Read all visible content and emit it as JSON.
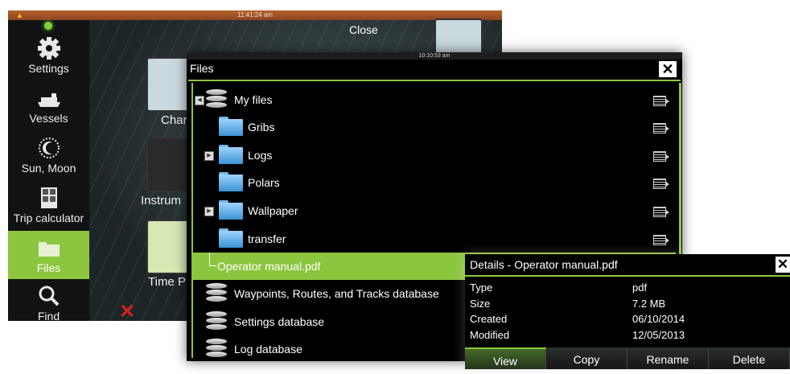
{
  "home": {
    "clock": "11:41:24 am",
    "close_label": "Close",
    "sidebar": [
      {
        "label": "Settings",
        "icon": "gear-icon"
      },
      {
        "label": "Vessels",
        "icon": "vessels-icon"
      },
      {
        "label": "Sun, Moon",
        "icon": "sun-moon-icon"
      },
      {
        "label": "Trip calculator",
        "icon": "calculator-icon"
      },
      {
        "label": "Files",
        "icon": "folder-icon",
        "active": true
      },
      {
        "label": "Find",
        "icon": "magnifier-icon"
      }
    ],
    "apps": [
      "Char",
      "Instrum",
      "Time P"
    ]
  },
  "files": {
    "clock": "10:10:53 am",
    "title": "Files",
    "items": [
      {
        "label": "My files",
        "icon": "database-icon"
      },
      {
        "label": "Gribs",
        "icon": "folder-icon"
      },
      {
        "label": "Logs",
        "icon": "folder-icon"
      },
      {
        "label": "Polars",
        "icon": "folder-icon"
      },
      {
        "label": "Wallpaper",
        "icon": "folder-icon"
      },
      {
        "label": "transfer",
        "icon": "folder-icon"
      },
      {
        "label": "Operator manual.pdf",
        "selected": true
      },
      {
        "label": "Waypoints, Routes, and Tracks database",
        "icon": "waypoints-db-icon"
      },
      {
        "label": "Settings database",
        "icon": "settings-db-icon"
      },
      {
        "label": "Log database",
        "icon": "database-icon"
      }
    ]
  },
  "details": {
    "title": "Details - Operator manual.pdf",
    "rows": [
      {
        "key": "Type",
        "value": "pdf"
      },
      {
        "key": "Size",
        "value": "7.2 MB"
      },
      {
        "key": "Created",
        "value": "06/10/2014"
      },
      {
        "key": "Modified",
        "value": "12/05/2013"
      }
    ],
    "buttons": [
      "View",
      "Copy",
      "Rename",
      "Delete"
    ]
  },
  "colors": {
    "accent": "#8cc63f",
    "topbar": "#b5622e"
  }
}
